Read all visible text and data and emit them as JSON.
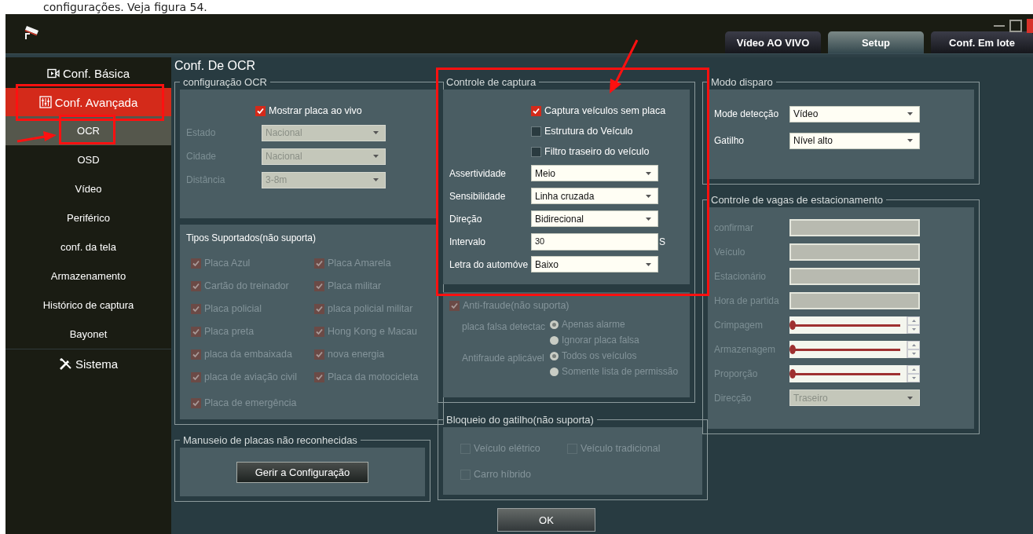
{
  "document_caption": "configurações. Veja figura 54.",
  "tabs": [
    {
      "label": "Vídeo AO VIVO",
      "selected": false
    },
    {
      "label": "Setup",
      "selected": true
    },
    {
      "label": "Conf. Em lote",
      "selected": false
    }
  ],
  "sidebar": [
    {
      "kind": "section",
      "label": "Conf. Básica",
      "selected": false
    },
    {
      "kind": "section",
      "label": "Conf. Avançada",
      "selected": true
    },
    {
      "kind": "item",
      "label": "OCR",
      "selected": true
    },
    {
      "kind": "item",
      "label": "OSD",
      "selected": false
    },
    {
      "kind": "item",
      "label": "Vídeo",
      "selected": false
    },
    {
      "kind": "item",
      "label": "Periférico",
      "selected": false
    },
    {
      "kind": "item",
      "label": "conf. da tela",
      "selected": false
    },
    {
      "kind": "item",
      "label": "Armazenamento",
      "selected": false
    },
    {
      "kind": "item",
      "label": "Histórico de captura",
      "selected": false
    },
    {
      "kind": "item",
      "label": "Bayonet",
      "selected": false
    },
    {
      "kind": "section",
      "label": "Sistema",
      "selected": false
    }
  ],
  "page_title": "Conf. De OCR",
  "ocr_config": {
    "title": "configuração OCR",
    "show_plate": {
      "label": "Mostrar placa ao vivo",
      "checked": true
    },
    "fields": [
      {
        "label": "Estado",
        "value": "Nacional",
        "disabled": true
      },
      {
        "label": "Cidade",
        "value": "Nacional",
        "disabled": true
      },
      {
        "label": "Distância",
        "value": "3-8m",
        "disabled": true
      }
    ],
    "supported": {
      "title": "Tipos Suportados(não suporta)",
      "disabled": true,
      "items": [
        {
          "label": "Placa Azul",
          "checked": true
        },
        {
          "label": "Placa Amarela",
          "checked": true
        },
        {
          "label": "Cartão do treinador",
          "checked": true
        },
        {
          "label": "Placa militar",
          "checked": true
        },
        {
          "label": "Placa policial",
          "checked": true
        },
        {
          "label": "placa policial militar",
          "checked": true
        },
        {
          "label": "Placa preta",
          "checked": true
        },
        {
          "label": "Hong Kong e Macau",
          "checked": true
        },
        {
          "label": "placa da embaixada",
          "checked": true
        },
        {
          "label": "nova energia",
          "checked": true
        },
        {
          "label": "placa de aviação civil",
          "checked": true
        },
        {
          "label": "Placa da motocicleta",
          "checked": true
        },
        {
          "label": "Placa de emergência",
          "checked": true
        }
      ]
    }
  },
  "unrecognized": {
    "title": "Manuseio de placas não reconhecidas",
    "button": "Gerir a Configuração"
  },
  "capture_control": {
    "title": "Controle de captura",
    "checks": [
      {
        "label": "Captura veículos sem placa",
        "checked": true
      },
      {
        "label": "Estrutura do Veículo",
        "checked": false
      },
      {
        "label": "Filtro traseiro do veículo",
        "checked": false
      }
    ],
    "fields": [
      {
        "label": "Assertividade",
        "kind": "select",
        "value": "Meio"
      },
      {
        "label": "Sensibilidade",
        "kind": "select",
        "value": "Linha cruzada"
      },
      {
        "label": "Direção",
        "kind": "select",
        "value": "Bidirecional"
      },
      {
        "label": "Intervalo",
        "kind": "text",
        "value": "30",
        "unit": "S"
      },
      {
        "label": "Letra do automóve",
        "kind": "select",
        "value": "Baixo"
      }
    ]
  },
  "anti_fraud": {
    "label": "Anti-fraude(não suporta)",
    "checked": true,
    "disabled": true,
    "groups": [
      {
        "label": "placa falsa detectac",
        "options": [
          {
            "label": "Apenas alarme",
            "selected": true
          },
          {
            "label": "Ignorar placa falsa",
            "selected": false
          }
        ]
      },
      {
        "label": "Antifraude aplicável",
        "options": [
          {
            "label": "Todos os veículos",
            "selected": true
          },
          {
            "label": "Somente lista de permissão",
            "selected": false
          }
        ]
      }
    ]
  },
  "trigger_lock": {
    "title": "Bloqueio do gatilho(não suporta)",
    "disabled": true,
    "items": [
      {
        "label": "Veículo elétrico",
        "checked": false
      },
      {
        "label": "Veículo tradicional",
        "checked": false
      },
      {
        "label": "Carro híbrido",
        "checked": false
      }
    ]
  },
  "ok_button": "OK",
  "trigger_mode": {
    "title": "Modo disparo",
    "fields": [
      {
        "label": "Mode detecção",
        "value": "Vídeo"
      },
      {
        "label": "Gatilho",
        "value": "Nível alto"
      }
    ]
  },
  "parking": {
    "title": "Controle de vagas de estacionamento",
    "disabled": true,
    "fields": [
      {
        "label": "confirmar",
        "kind": "text"
      },
      {
        "label": "Veículo",
        "kind": "text"
      },
      {
        "label": "Estacionário",
        "kind": "text"
      },
      {
        "label": "Hora de partida",
        "kind": "text"
      },
      {
        "label": "Crimpagem",
        "kind": "slider",
        "level": 0
      },
      {
        "label": "Armazenagem",
        "kind": "slider",
        "level": 0
      },
      {
        "label": "Proporção",
        "kind": "slider",
        "level": 0
      },
      {
        "label": "Direcção",
        "kind": "select",
        "value": "Traseiro"
      }
    ]
  }
}
